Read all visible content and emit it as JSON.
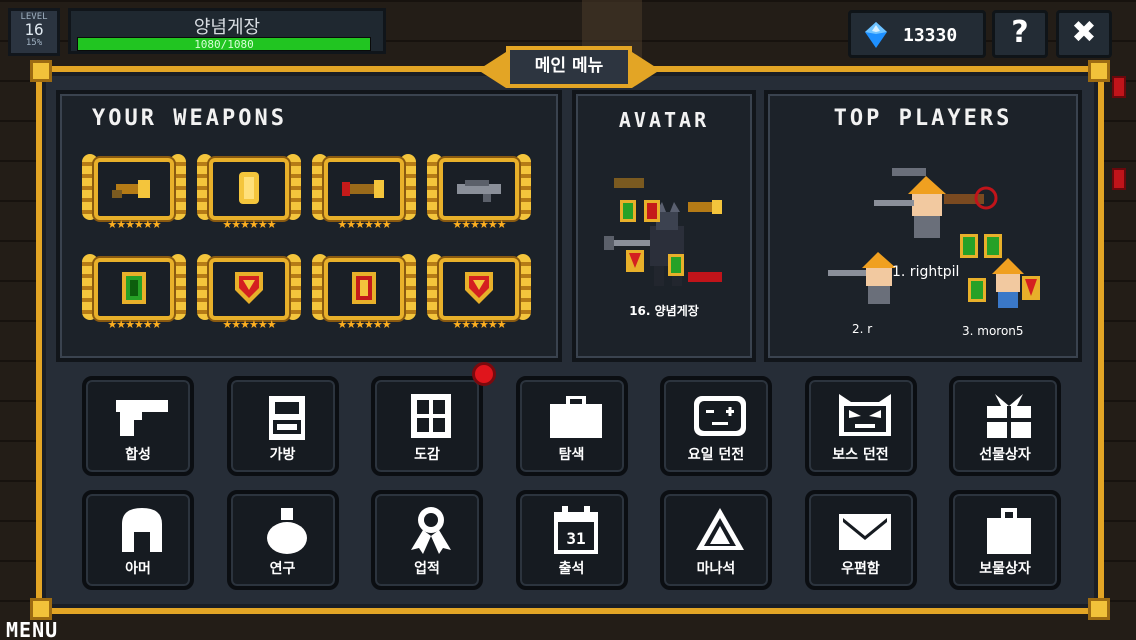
{
  "hud": {
    "level_label": "LEVEL",
    "level": "16",
    "level_pct": "15%",
    "player_name": "양념게장",
    "hp_text": "1080/1080",
    "hp_fraction": 1.0,
    "gems": "13330",
    "help_label": "?",
    "close_label": "✖"
  },
  "panel": {
    "title": "메인 메뉴"
  },
  "weapons": {
    "title": "YOUR WEAPONS",
    "slots": [
      {
        "icon": "winged-gun-icon",
        "stars": "★★★★★★"
      },
      {
        "icon": "gold-coin-icon",
        "stars": "★★★★★★"
      },
      {
        "icon": "winged-blaster-icon",
        "stars": "★★★★★★"
      },
      {
        "icon": "heavy-rifle-icon",
        "stars": "★★★★★★"
      },
      {
        "icon": "green-armor-icon",
        "stars": "★★★★★★"
      },
      {
        "icon": "red-shield-icon",
        "stars": "★★★★★★"
      },
      {
        "icon": "red-armor-icon",
        "stars": "★★★★★★"
      },
      {
        "icon": "red-shield-icon",
        "stars": "★★★★★★"
      }
    ]
  },
  "avatar": {
    "title": "AVATAR",
    "name": "16. 양념게장"
  },
  "top_players": {
    "title": "TOP PLAYERS",
    "players": [
      {
        "label": "1. rightpil"
      },
      {
        "label": "2. r"
      },
      {
        "label": "3. moron5"
      }
    ]
  },
  "menu_buttons": [
    {
      "label": "합성",
      "icon": "pistol-icon"
    },
    {
      "label": "가방",
      "icon": "backpack-icon"
    },
    {
      "label": "도감",
      "icon": "grid-book-icon"
    },
    {
      "label": "탐색",
      "icon": "briefcase-icon"
    },
    {
      "label": "요일 던전",
      "icon": "gamepad-face-icon"
    },
    {
      "label": "보스 던전",
      "icon": "demon-face-icon"
    },
    {
      "label": "선물상자",
      "icon": "gift-box-icon"
    },
    {
      "label": "아머",
      "icon": "helmet-icon"
    },
    {
      "label": "연구",
      "icon": "flask-icon"
    },
    {
      "label": "업적",
      "icon": "medal-icon"
    },
    {
      "label": "출석",
      "icon": "calendar-icon"
    },
    {
      "label": "마나석",
      "icon": "mana-stone-icon"
    },
    {
      "label": "우편함",
      "icon": "envelope-icon"
    },
    {
      "label": "보물상자",
      "icon": "treasure-bag-icon"
    }
  ],
  "calendar_day": "31",
  "footer": {
    "menu_label": "MENU"
  },
  "colors": {
    "panel_border": "#e3a525",
    "hp_green": "#21c521",
    "gem_blue": "#1e90ff",
    "alert_red": "#e0151c"
  }
}
